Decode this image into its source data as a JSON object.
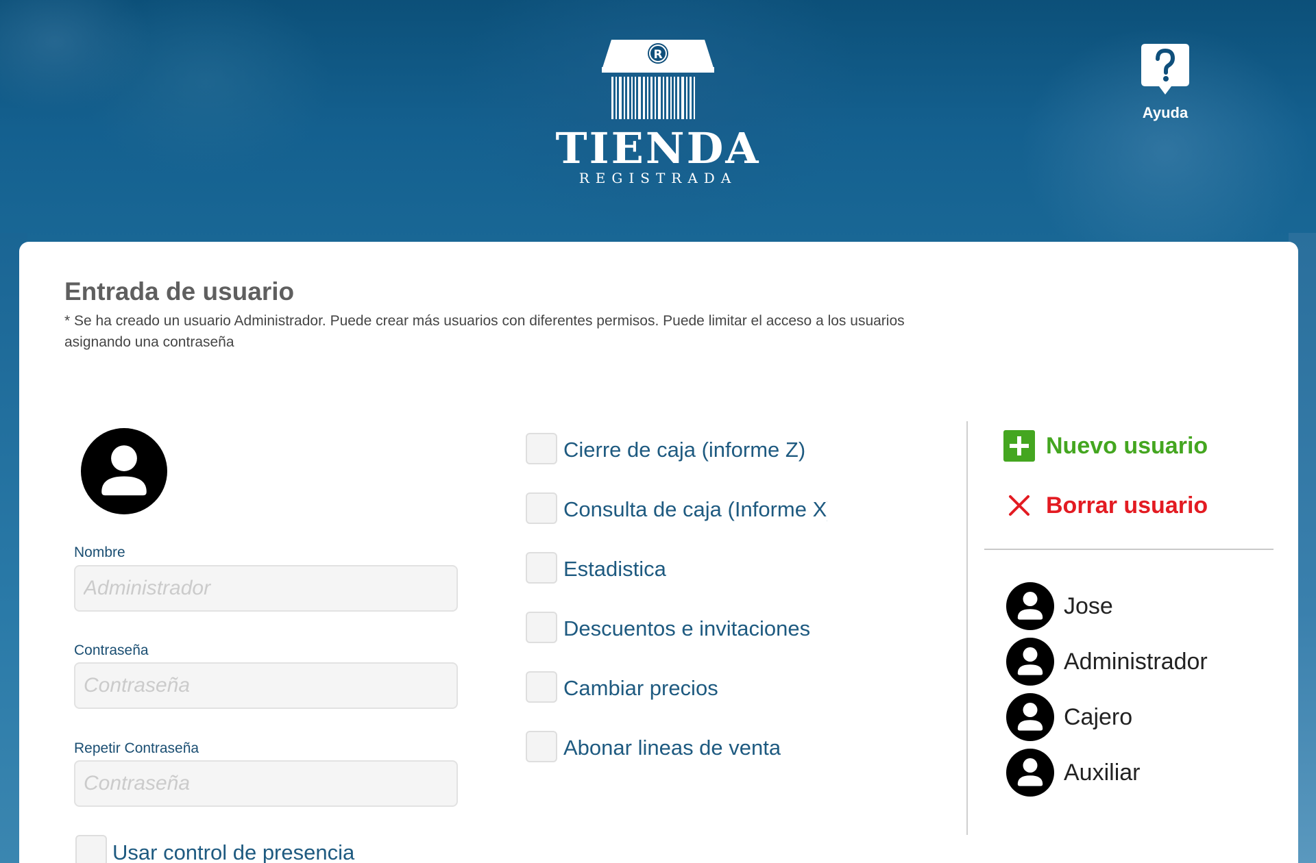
{
  "header": {
    "logo_title": "TIENDA",
    "logo_subtitle": "REGISTRADA",
    "logo_badge": "R",
    "help_label": "Ayuda"
  },
  "main": {
    "title": "Entrada de usuario",
    "description": "* Se ha creado un usuario Administrador. Puede crear más usuarios con diferentes permisos. Puede limitar el acceso a los usuarios asignando una contraseña"
  },
  "form": {
    "name_label": "Nombre",
    "name_placeholder": "Administrador",
    "password_label": "Contraseña",
    "password_placeholder": "Contraseña",
    "repeat_label": "Repetir Contraseña",
    "repeat_placeholder": "Contraseña",
    "presence_label": "Usar control de presencia"
  },
  "permissions": [
    {
      "label": "Cierre de caja (informe Z)",
      "checked": false
    },
    {
      "label": "Consulta de caja (Informe X)",
      "checked": false
    },
    {
      "label": "Estadistica",
      "checked": false
    },
    {
      "label": "Descuentos e invitaciones",
      "checked": false
    },
    {
      "label": "Cambiar precios",
      "checked": false
    },
    {
      "label": "Abonar lineas de venta",
      "checked": false
    }
  ],
  "actions": {
    "new_user": "Nuevo usuario",
    "delete_user": "Borrar usuario"
  },
  "users": [
    "Jose",
    "Administrador",
    "Cajero",
    "Auxiliar"
  ],
  "colors": {
    "brand_blue": "#0f4f7b",
    "label_blue": "#1e5a80",
    "new_green": "#44a620",
    "delete_red": "#e31b22"
  }
}
